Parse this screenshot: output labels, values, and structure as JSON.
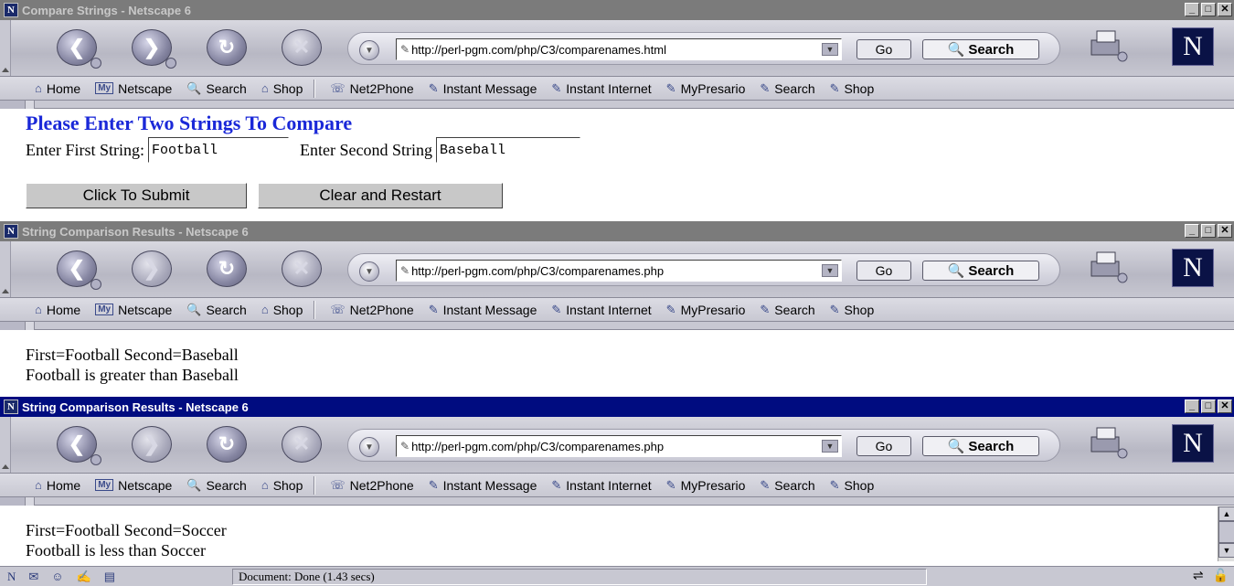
{
  "windows": [
    {
      "title": "Compare Strings - Netscape 6",
      "active": false,
      "url": "http://perl-pgm.com/php/C3/comparenames.html",
      "forward_enabled": true,
      "page": {
        "heading": "Please Enter Two Strings To Compare",
        "first_label": "Enter First String:",
        "first_value": "Football",
        "second_label": "Enter Second String",
        "second_value": "Baseball",
        "submit_label": "Click To Submit",
        "reset_label": "Clear and Restart"
      }
    },
    {
      "title": "String Comparison Results - Netscape 6",
      "active": false,
      "url": "http://perl-pgm.com/php/C3/comparenames.php",
      "forward_enabled": false,
      "page": {
        "line1": "First=Football Second=Baseball",
        "line2": "Football is greater than Baseball"
      }
    },
    {
      "title": "String Comparison Results - Netscape 6",
      "active": true,
      "url": "http://perl-pgm.com/php/C3/comparenames.php",
      "forward_enabled": false,
      "page": {
        "line1": "First=Football Second=Soccer",
        "line2": "Football is less than Soccer"
      },
      "status": "Document: Done (1.43 secs)"
    }
  ],
  "toolbar": {
    "go_label": "Go",
    "search_label": "Search"
  },
  "personal_bar": {
    "home": "Home",
    "my_netscape": "Netscape",
    "search": "Search",
    "shop": "Shop",
    "net2phone": "Net2Phone",
    "instant_message": "Instant Message",
    "instant_internet": "Instant Internet",
    "mypresario": "MyPresario",
    "search2": "Search",
    "shop2": "Shop"
  },
  "icons": {
    "netscape": "N",
    "my": "My"
  }
}
